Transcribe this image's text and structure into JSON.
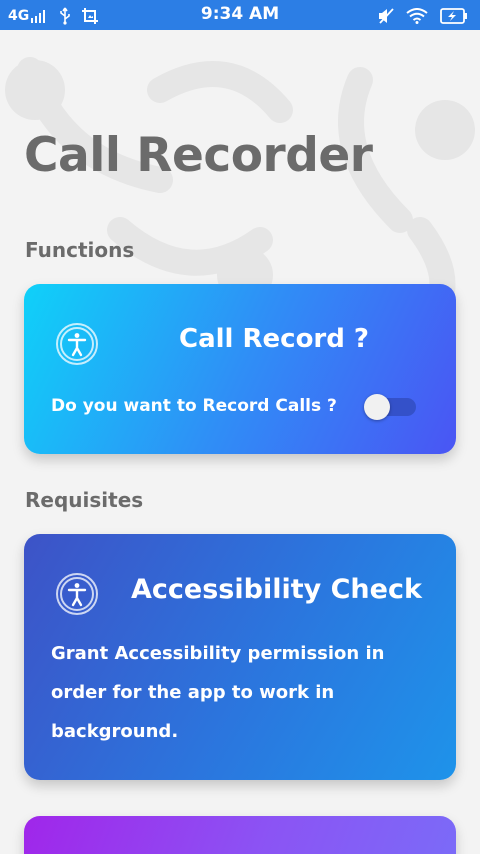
{
  "status_bar": {
    "network": "4G",
    "time": "9:34 AM"
  },
  "page": {
    "title": "Call Recorder"
  },
  "sections": {
    "functions": "Functions",
    "requisites": "Requisites"
  },
  "call_record_card": {
    "icon": "accessibility-icon",
    "title": "Call Record ?",
    "question": "Do you want to Record Calls ?",
    "toggle_on": false
  },
  "accessibility_card": {
    "icon": "accessibility-icon",
    "title": "Accessibility Check",
    "description": "Grant Accessibility permission in order for the app to work in background."
  },
  "colors": {
    "status_bar": "#2c7ee5",
    "title_gray": "#6b6b6b",
    "call_card_start": "#0fd1f9",
    "call_card_end": "#4a55f4",
    "access_card_start": "#3d53c7",
    "access_card_end": "#1e93ea",
    "purple_card": "#a026ea"
  }
}
